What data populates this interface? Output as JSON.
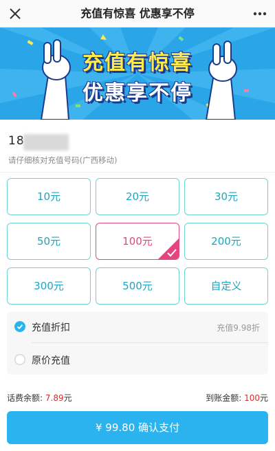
{
  "header": {
    "title": "充值有惊喜 优惠享不停",
    "close_icon": "close-icon",
    "more_icon": "more-icon"
  },
  "banner": {
    "line1": "充值有惊喜",
    "line2": "优惠享不停"
  },
  "phone": {
    "number_visible": "18",
    "hint": "请仔细核对充值号码(广西移动)"
  },
  "amounts": [
    {
      "label": "10元"
    },
    {
      "label": "20元"
    },
    {
      "label": "30元"
    },
    {
      "label": "50元"
    },
    {
      "label": "100元",
      "selected": true
    },
    {
      "label": "200元"
    },
    {
      "label": "300元"
    },
    {
      "label": "500元"
    },
    {
      "label": "自定义"
    }
  ],
  "options": {
    "discount": {
      "label": "充值折扣",
      "note": "充值9.98折",
      "checked": true
    },
    "original": {
      "label": "原价充值",
      "checked": false
    }
  },
  "summary": {
    "balance_label": "话费余额:",
    "balance_value": "7.89",
    "balance_unit": "元",
    "credit_label": "到账金额:",
    "credit_value": "100",
    "credit_unit": "元"
  },
  "pay_button": {
    "label": "¥ 99.80 确认支付"
  },
  "colors": {
    "accent": "#2bb3f0",
    "amount_border": "#6fd3d3",
    "amount_text": "#1fa5c0",
    "selected": "#e5457f",
    "value_red": "#d4302a"
  }
}
